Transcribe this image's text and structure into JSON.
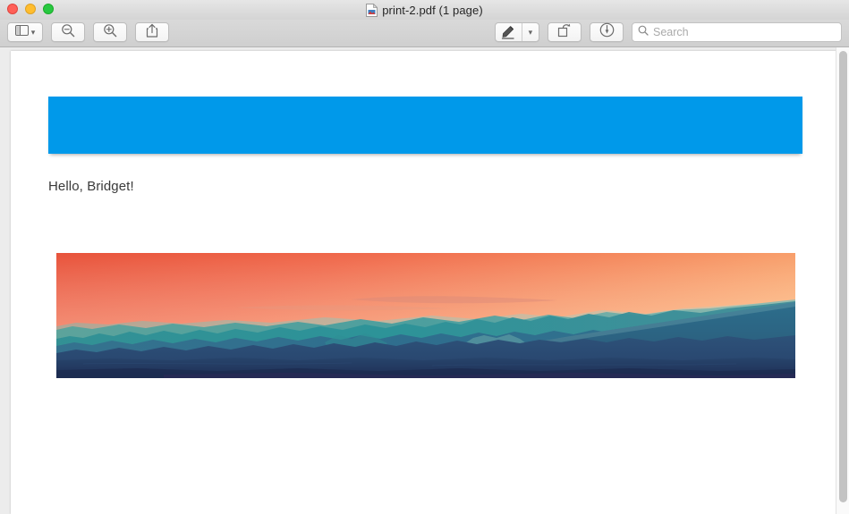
{
  "window": {
    "title": "print-2.pdf (1 page)",
    "doc_icon": "pdf-document-icon",
    "traffic_lights": [
      {
        "name": "close-button",
        "label": "Close",
        "color": "#ff5f57"
      },
      {
        "name": "minimize-button",
        "label": "Minimize",
        "color": "#ffbd2e"
      },
      {
        "name": "maximize-button",
        "label": "Maximize",
        "color": "#28c840"
      }
    ]
  },
  "toolbar": {
    "sidebar_toggle": {
      "icon": "sidebar-icon",
      "chevron": "▾",
      "tooltip": "View"
    },
    "zoom_out": {
      "icon": "zoom-out-icon",
      "tooltip": "Zoom Out"
    },
    "zoom_in": {
      "icon": "zoom-in-icon",
      "tooltip": "Zoom In"
    },
    "share": {
      "icon": "share-icon",
      "tooltip": "Share"
    },
    "markup": {
      "icon": "markup-pen-icon",
      "chevron": "▾",
      "tooltip": "Show Markup Toolbar"
    },
    "rotate": {
      "icon": "rotate-left-icon",
      "tooltip": "Rotate Left"
    },
    "sign": {
      "icon": "sign-annotate-icon",
      "tooltip": "Highlight"
    },
    "search": {
      "icon": "search-icon",
      "placeholder": "Search",
      "value": ""
    }
  },
  "document": {
    "banner": {
      "color": "#0099ea"
    },
    "greeting": "Hello, Bridget!",
    "hero_image": {
      "alt": "sunset-mountain-landscape",
      "sky_top_left": "#e8573f",
      "sky_top_right": "#f9a468",
      "ridge_teal": "#2a9aa0",
      "ridge_mid": "#3d7f99",
      "foreground": "#23365f",
      "foreground_bottom": "#1e2f56"
    }
  },
  "scrollbar": {
    "name": "vertical-scrollbar"
  }
}
